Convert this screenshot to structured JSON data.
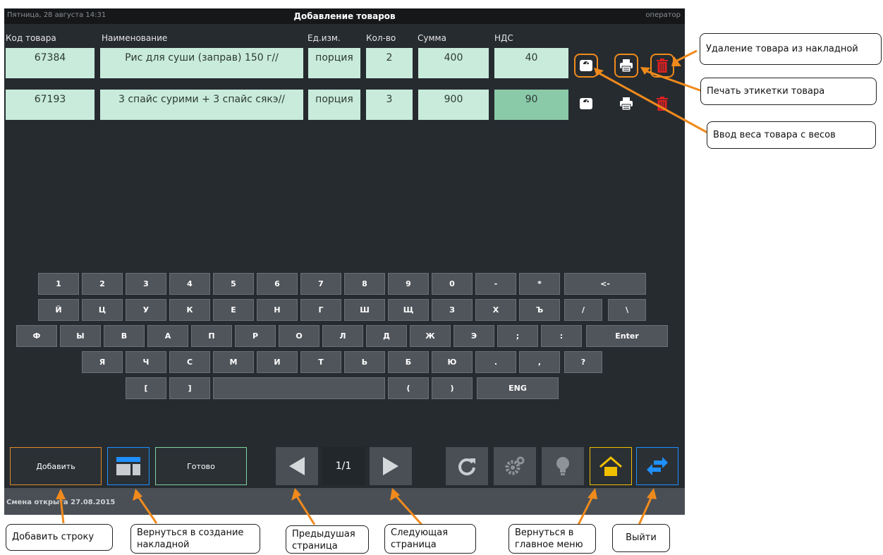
{
  "titlebar": {
    "date": "Пятница, 28 августа 14:31",
    "title": "Добавление товаров",
    "operator": "оператор"
  },
  "table": {
    "headers": [
      "Код товара",
      "Наименование",
      "Ед.изм.",
      "Кол-во",
      "Сумма",
      "НДС"
    ],
    "rows": [
      {
        "code": "67384",
        "name": "Рис для суши (заправ) 150 г//",
        "unit": "порция",
        "qty": "2",
        "sum": "400",
        "vat": "40",
        "vat_highlighted": false
      },
      {
        "code": "67193",
        "name": "3 спайс сурими + 3 спайс сякэ//",
        "unit": "порция",
        "qty": "3",
        "sum": "900",
        "vat": "90",
        "vat_highlighted": true
      }
    ]
  },
  "row_actions": [
    {
      "name": "scale-weight-icon",
      "color": "#ffffff"
    },
    {
      "name": "print-label-icon",
      "color": "#ffffff"
    },
    {
      "name": "delete-icon",
      "color": "#e02020"
    }
  ],
  "keyboard": {
    "row1": [
      "1",
      "2",
      "3",
      "4",
      "5",
      "6",
      "7",
      "8",
      "9",
      "0",
      "-",
      "*",
      "<-"
    ],
    "row2": [
      "Й",
      "Ц",
      "У",
      "К",
      "Е",
      "Н",
      "Г",
      "Ш",
      "Щ",
      "З",
      "Х",
      "Ъ",
      "/",
      "\\"
    ],
    "row3": [
      "Ф",
      "Ы",
      "В",
      "А",
      "П",
      "Р",
      "О",
      "Л",
      "Д",
      "Ж",
      "Э",
      ";",
      ":",
      "Enter"
    ],
    "row4": [
      "Я",
      "Ч",
      "С",
      "М",
      "И",
      "Т",
      "Ь",
      "Б",
      "Ю",
      ".",
      ",",
      "?"
    ],
    "row5": [
      "[",
      "]",
      "",
      "(",
      ")",
      "ENG"
    ]
  },
  "bottom": {
    "add_label": "Добавить",
    "done_label": "Готово",
    "page_indicator": "1/1",
    "icons": [
      "layout-icon",
      "prev-page-icon",
      "next-page-icon",
      "refresh-icon",
      "settings-icon",
      "bulb-icon",
      "home-icon",
      "exit-icon"
    ],
    "accent_orange": "#e08a28",
    "accent_blue": "#1e90ff",
    "accent_green": "#7fd39f",
    "accent_yellow": "#f0c000"
  },
  "status": {
    "shift_text": "Смена открыта 27.08.2015"
  },
  "callouts": {
    "delete": "Удаление товара из накладной",
    "print": "Печать этикетки товара",
    "weight": "Ввод веса товара с весов",
    "add_row": "Добавить строку",
    "back_to_invoice": "Вернуться в создание накладной",
    "prev_page": "Предыдушая страница",
    "next_page": "Следующая страница",
    "main_menu": "Вернуться в главное меню",
    "exit": "Выйти"
  }
}
